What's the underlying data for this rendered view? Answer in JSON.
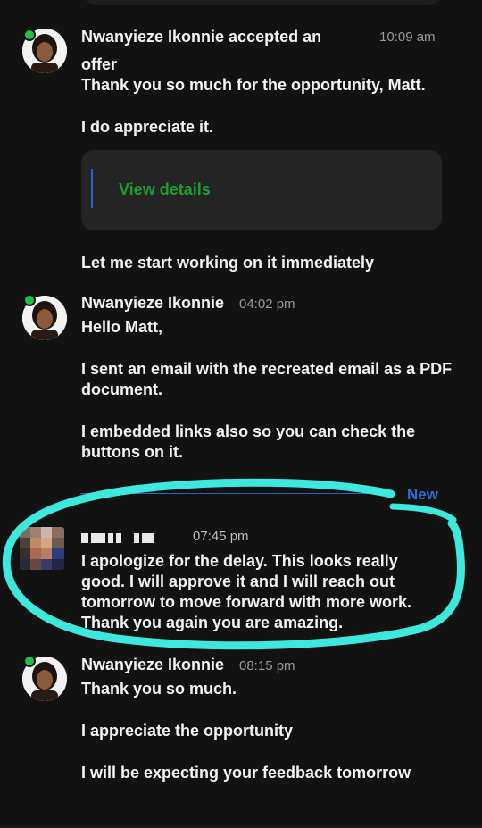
{
  "messages": [
    {
      "sender": "Nwanyieze Ikonnie accepted an",
      "sender_cont": "offer",
      "time": "10:09 am",
      "lines": [
        "Thank you so much for the opportunity, Matt.",
        "I do appreciate it."
      ],
      "card": {
        "link": "View details"
      },
      "after": "Let me start working on it immediately"
    },
    {
      "sender": "Nwanyieze Ikonnie",
      "time": "04:02 pm",
      "lines": [
        "Hello Matt,",
        "I sent an email with the recreated email as a PDF document.",
        "I embedded links also so you can check the buttons on it."
      ]
    },
    {
      "sender": "",
      "time": "07:45 pm",
      "lines": [
        "I apologize for the delay. This looks really good. I will approve it and I will reach out tomorrow to move forward with more work. Thank you again you are amazing."
      ]
    },
    {
      "sender": "Nwanyieze Ikonnie",
      "time": "08:15 pm",
      "lines": [
        "Thank you so much.",
        "I appreciate the opportunity",
        "I will be expecting your feedback tomorrow"
      ]
    }
  ],
  "divider": {
    "label": "New"
  },
  "colors": {
    "online": "#1fbf4a",
    "link": "#1c9e2f",
    "new": "#2f6cd8",
    "highlight": "#3de8dc"
  }
}
